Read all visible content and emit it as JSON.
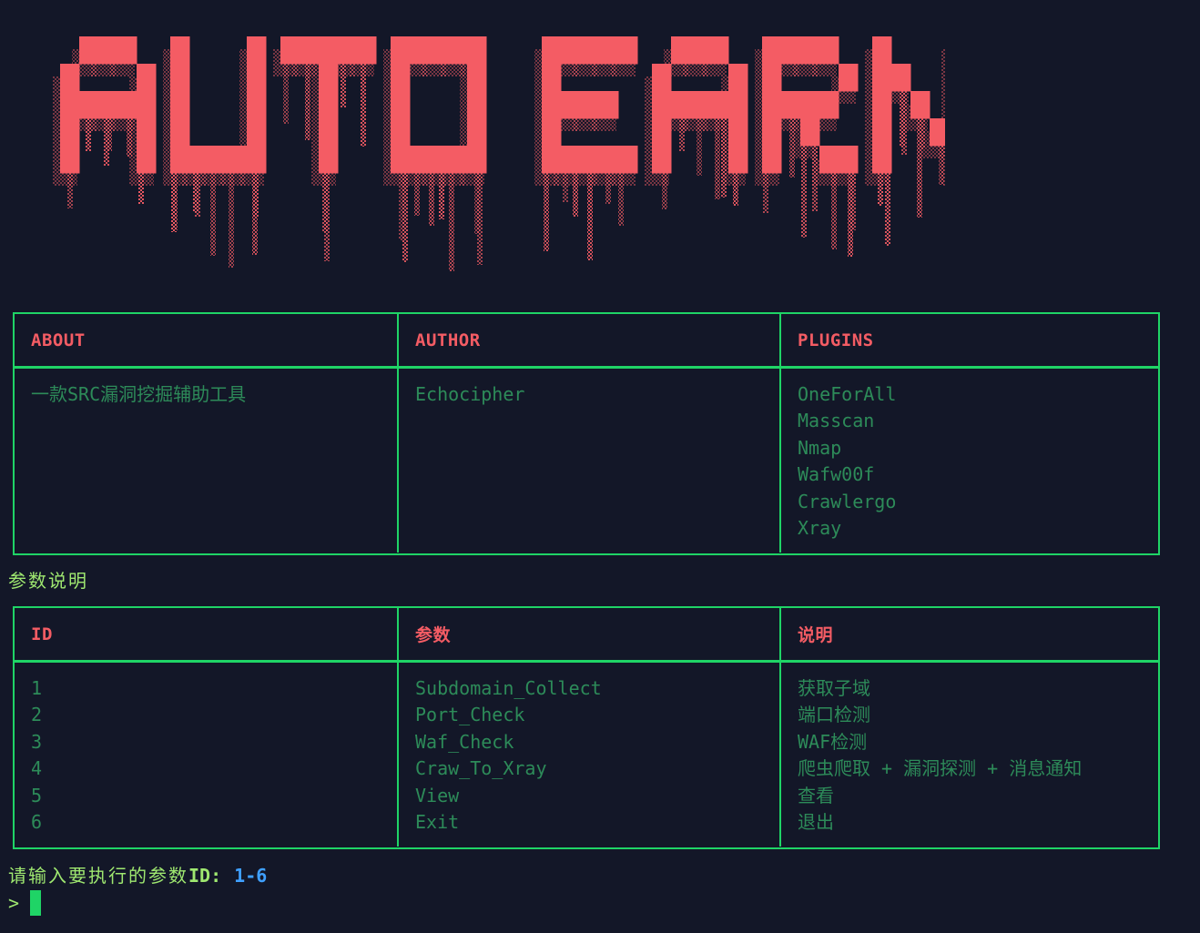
{
  "banner": {
    "text": "AUTO EARN",
    "color": "#f45c64"
  },
  "info_table": {
    "headers": [
      "ABOUT",
      "AUTHOR",
      "PLUGINS"
    ],
    "about": [
      "一款SRC漏洞挖掘辅助工具"
    ],
    "author": [
      "Echocipher"
    ],
    "plugins": [
      "OneForAll",
      "Masscan",
      "Nmap",
      "Wafw00f",
      "Crawlergo",
      "Xray"
    ]
  },
  "section_label": "参数说明",
  "param_table": {
    "headers": [
      "ID",
      "参数",
      "说明"
    ],
    "rows": [
      {
        "id": "1",
        "param": "Subdomain_Collect",
        "desc": "获取子域"
      },
      {
        "id": "2",
        "param": "Port_Check",
        "desc": "端口检测"
      },
      {
        "id": "3",
        "param": "Waf_Check",
        "desc": "WAF检测"
      },
      {
        "id": "4",
        "param": "Craw_To_Xray",
        "desc": "爬虫爬取 + 漏洞探测 + 消息通知"
      },
      {
        "id": "5",
        "param": "View",
        "desc": "查看"
      },
      {
        "id": "6",
        "param": "Exit",
        "desc": "退出"
      }
    ]
  },
  "prompt": {
    "text": "请输入要执行的参数",
    "id_label": "ID:",
    "range": "1-6",
    "symbol": ">"
  },
  "colors": {
    "background": "#131728",
    "border": "#1fd466",
    "header_text": "#f45c64",
    "cell_text": "#2d8b59",
    "prompt_text": "#9fe870",
    "range_text": "#3fa0ff"
  }
}
